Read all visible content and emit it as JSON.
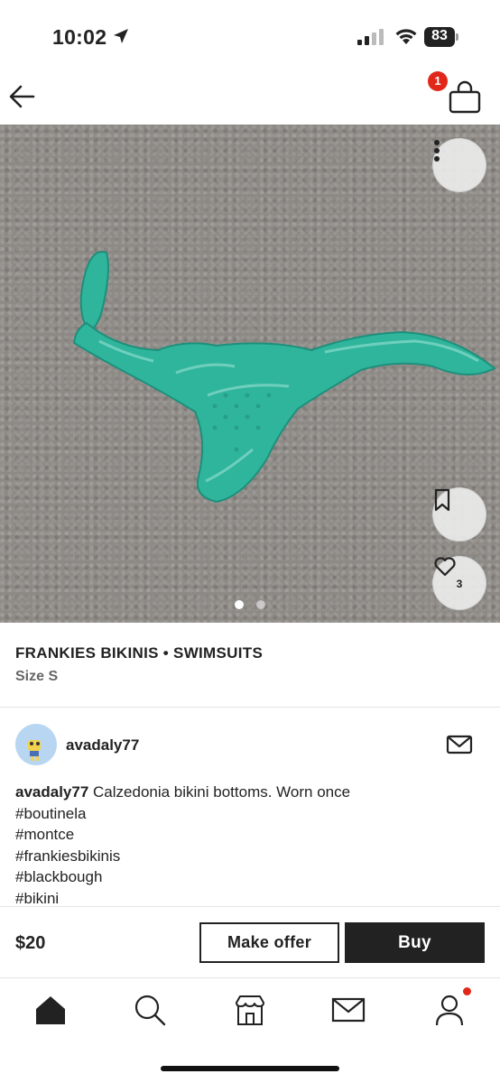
{
  "status_bar": {
    "time": "10:02",
    "battery": "83"
  },
  "header": {
    "cart_count": "1"
  },
  "product": {
    "brand_line": "FRANKIES BIKINIS • SWIMSUITS",
    "size": "Size S",
    "like_count": "3",
    "image_count": 2,
    "active_image": 1
  },
  "seller": {
    "username": "avadaly77"
  },
  "description": {
    "user": "avadaly77",
    "text": " Calzedonia bikini bottoms. Worn once",
    "hashtags": [
      "#boutinela",
      "#montce",
      "#frankiesbikinis",
      "#blackbough",
      "#bikini"
    ]
  },
  "action_bar": {
    "price": "$20",
    "offer_label": "Make offer",
    "buy_label": "Buy"
  },
  "tabs": [
    "home-icon",
    "search-icon",
    "shop-icon",
    "inbox-icon",
    "profile-icon"
  ],
  "colors": {
    "accent": "#222222",
    "badge": "#e0271a",
    "avatar_bg": "#b8d6f2",
    "garment": "#2db8a0"
  }
}
